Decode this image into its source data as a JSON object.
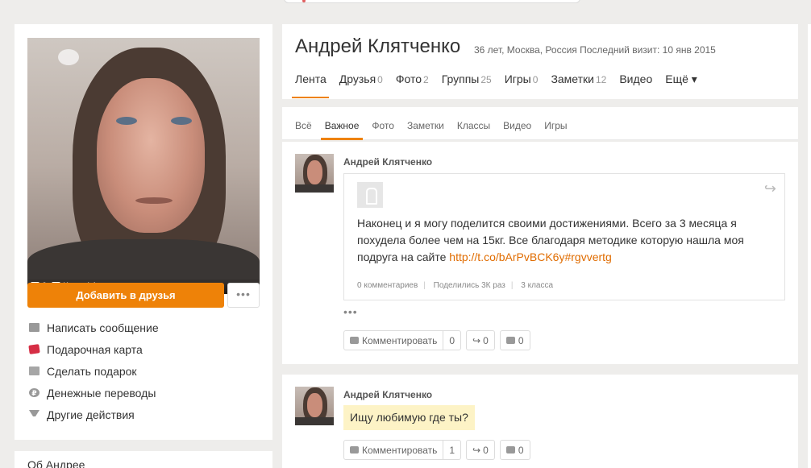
{
  "profile": {
    "name": "Андрей Клятченко",
    "meta": "36 лет, Москва, Россия Последний визит: 10 янв 2015",
    "avatar_comments": "0",
    "avatar_class": "Класс! 1"
  },
  "tabs": [
    {
      "label": "Лента",
      "count": ""
    },
    {
      "label": "Друзья",
      "count": "0"
    },
    {
      "label": "Фото",
      "count": "2"
    },
    {
      "label": "Группы",
      "count": "25"
    },
    {
      "label": "Игры",
      "count": "0"
    },
    {
      "label": "Заметки",
      "count": "12"
    },
    {
      "label": "Видео",
      "count": ""
    },
    {
      "label": "Ещё ▾",
      "count": ""
    }
  ],
  "filters": [
    "Всё",
    "Важное",
    "Фото",
    "Заметки",
    "Классы",
    "Видео",
    "Игры"
  ],
  "left": {
    "add_friend": "Добавить в друзья",
    "more": "•••",
    "actions": [
      "Написать сообщение",
      "Подарочная карта",
      "Сделать подарок",
      "Денежные переводы",
      "Другие действия"
    ],
    "about": "Об Андрее"
  },
  "posts": [
    {
      "author": "Андрей Клятченко",
      "text": "Наконец и я могу поделится своими достижениями. Всего за 3 месяца я похудела более чем на 15кг. Все благодаря методике которую нашла моя подруга на сайте ",
      "link": "http://t.co/bArPvBCK6y#rgvvertg",
      "stats": [
        "0 комментариев",
        "Поделились 3К раз",
        "3 класса"
      ],
      "ellipsis": "•••",
      "comment_label": "Комментировать",
      "comments": "0",
      "shares": "0",
      "likes": "0"
    },
    {
      "author": "Андрей Клятченко",
      "text": "Ищу любимую где ты?",
      "comment_label": "Комментировать",
      "comments": "1",
      "shares": "0",
      "likes": "0"
    }
  ],
  "icons": {
    "share": "share-arrow-icon",
    "comment": "comment-bubble-icon",
    "like": "thumb-up-icon"
  },
  "colors": {
    "accent": "#ee8208",
    "link": "#e06c00",
    "gift_card": "#d62e45",
    "bubble": "#fdf3c6"
  }
}
